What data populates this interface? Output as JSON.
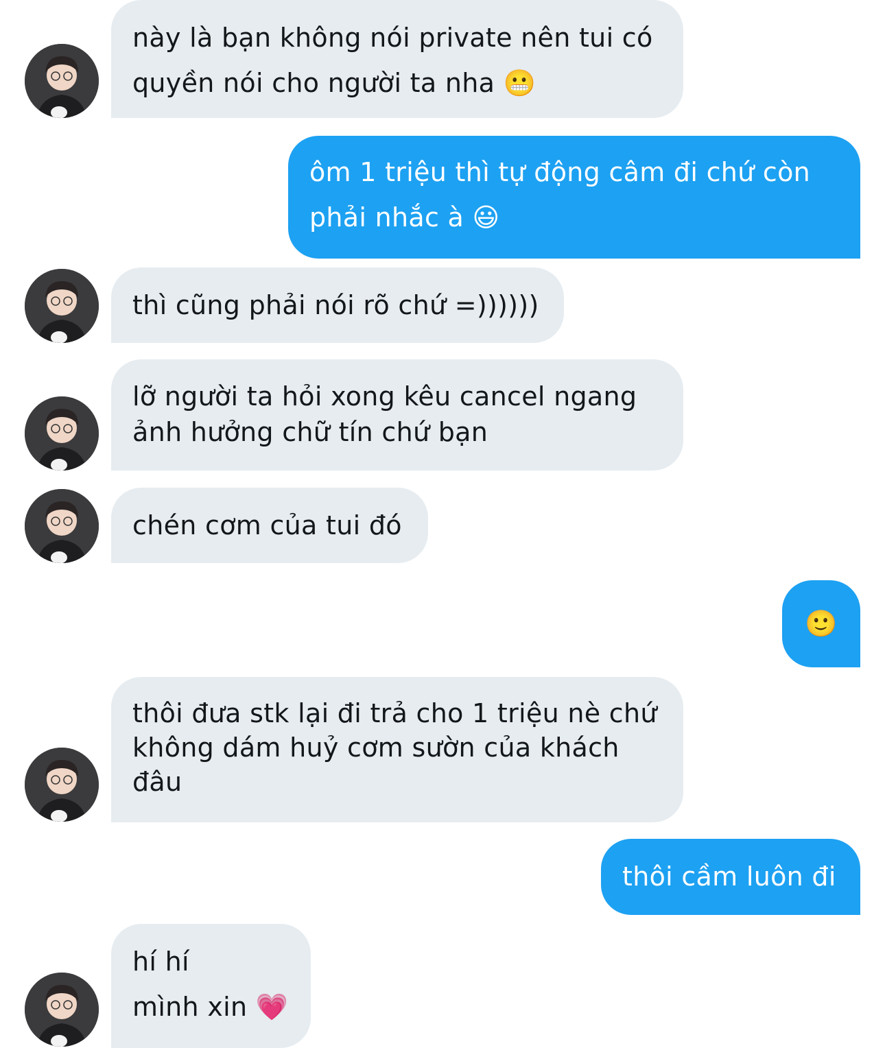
{
  "messages": [
    {
      "side": "in",
      "lines": [
        "này là bạn không nói private nên tui có",
        "quyền nói cho người ta nha 😬"
      ]
    },
    {
      "side": "out",
      "lines": [
        "ôm 1 triệu thì tự động câm đi chứ còn",
        "phải nhắc à 😃"
      ]
    },
    {
      "side": "in",
      "lines": [
        "thì cũng phải nói rõ chứ =))))))"
      ]
    },
    {
      "side": "in",
      "lines": [
        "lỡ người ta hỏi xong kêu cancel ngang",
        "ảnh hưởng chữ tín chứ bạn"
      ]
    },
    {
      "side": "in",
      "lines": [
        "chén cơm của tui đó"
      ]
    },
    {
      "side": "out",
      "lines": [
        "🙂"
      ]
    },
    {
      "side": "in",
      "lines": [
        "thôi đưa stk lại đi trả cho 1 triệu nè chứ",
        "không dám huỷ cơm sườn của khách",
        "đâu"
      ]
    },
    {
      "side": "out",
      "lines": [
        "thôi cầm luôn đi"
      ]
    },
    {
      "side": "in",
      "lines": [
        "hí hí",
        "mình xin 💗"
      ]
    }
  ],
  "colors": {
    "incoming_bubble": "#e6ecf0",
    "outgoing_bubble": "#1da1f2"
  },
  "avatar_icon": "user-avatar-photo"
}
